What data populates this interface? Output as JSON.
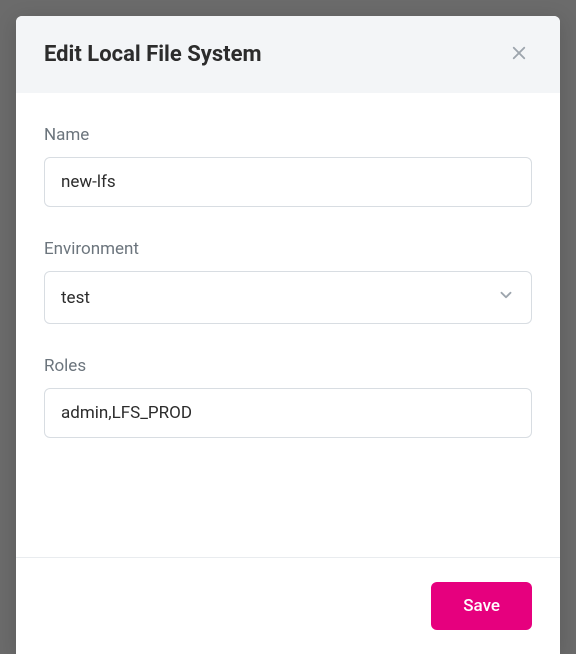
{
  "modal": {
    "title": "Edit Local File System",
    "fields": {
      "name": {
        "label": "Name",
        "value": "new-lfs"
      },
      "environment": {
        "label": "Environment",
        "value": "test"
      },
      "roles": {
        "label": "Roles",
        "value": "admin,LFS_PROD"
      }
    },
    "footer": {
      "save_label": "Save"
    }
  }
}
